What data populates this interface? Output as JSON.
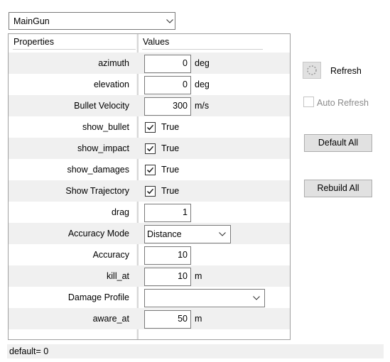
{
  "object_select": {
    "value": "MainGun"
  },
  "grid": {
    "headers": {
      "properties": "Properties",
      "values": "Values"
    },
    "rows": [
      {
        "name": "azimuth",
        "type": "number",
        "value": "0",
        "unit": "deg"
      },
      {
        "name": "elevation",
        "type": "number",
        "value": "0",
        "unit": "deg"
      },
      {
        "name": "Bullet Velocity",
        "type": "number",
        "value": "300",
        "unit": "m/s"
      },
      {
        "name": "show_bullet",
        "type": "bool",
        "checked": true,
        "label": "True"
      },
      {
        "name": "show_impact",
        "type": "bool",
        "checked": true,
        "label": "True"
      },
      {
        "name": "show_damages",
        "type": "bool",
        "checked": true,
        "label": "True"
      },
      {
        "name": "Show Trajectory",
        "type": "bool",
        "checked": true,
        "label": "True"
      },
      {
        "name": "drag",
        "type": "number",
        "value": "1",
        "unit": ""
      },
      {
        "name": "Accuracy Mode",
        "type": "enum",
        "value": "Distance",
        "combo": "short"
      },
      {
        "name": "Accuracy",
        "type": "number",
        "value": "10",
        "unit": ""
      },
      {
        "name": "kill_at",
        "type": "number",
        "value": "10",
        "unit": "m"
      },
      {
        "name": "Damage Profile",
        "type": "enum",
        "value": "",
        "combo": "wide"
      },
      {
        "name": "aware_at",
        "type": "number",
        "value": "50",
        "unit": "m"
      }
    ]
  },
  "panel": {
    "refresh_label": "Refresh",
    "refresh_icon": "spinner-icon",
    "auto_refresh_label": "Auto Refresh",
    "auto_refresh_checked": false,
    "default_all_label": "Default All",
    "rebuild_all_label": "Rebuild All"
  },
  "status": {
    "text": "default= 0"
  },
  "colors": {
    "row_shade": "#f0f0f0",
    "button_face": "#e1e1e1",
    "disabled_text": "#8a8a8a"
  }
}
